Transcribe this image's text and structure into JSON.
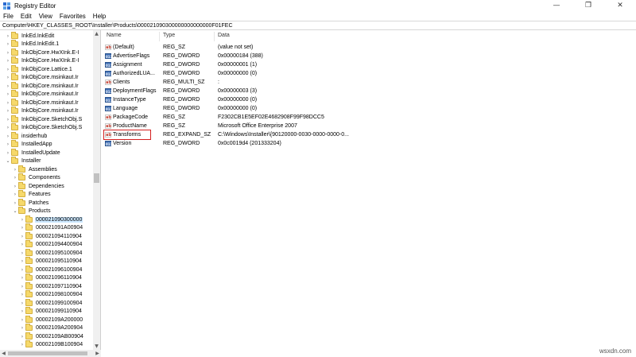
{
  "window": {
    "title": "Registry Editor",
    "controls": {
      "minimize": "—",
      "maximize": "❐",
      "close": "✕"
    }
  },
  "menu": [
    "File",
    "Edit",
    "View",
    "Favorites",
    "Help"
  ],
  "address": "Computer\\HKEY_CLASSES_ROOT\\Installer\\Products\\000021090300000000000000F01FEC",
  "tree": [
    {
      "label": "InkEd.InkEdit",
      "indent": 1,
      "chevron": "›"
    },
    {
      "label": "InkEd.InkEdit.1",
      "indent": 1,
      "chevron": "›"
    },
    {
      "label": "InkObjCore.HwXInk.E-I",
      "indent": 1,
      "chevron": "›"
    },
    {
      "label": "InkObjCore.HwXInk.E-I",
      "indent": 1,
      "chevron": "›"
    },
    {
      "label": "InkObjCore.Lattice.1",
      "indent": 1,
      "chevron": "›"
    },
    {
      "label": "InkObjCore.msinkaut.Ir",
      "indent": 1,
      "chevron": "›"
    },
    {
      "label": "InkObjCore.msinkaut.Ir",
      "indent": 1,
      "chevron": "›"
    },
    {
      "label": "InkObjCore.msinkaut.Ir",
      "indent": 1,
      "chevron": "›"
    },
    {
      "label": "InkObjCore.msinkaut.Ir",
      "indent": 1,
      "chevron": "›"
    },
    {
      "label": "InkObjCore.msinkaut.Ir",
      "indent": 1,
      "chevron": "›"
    },
    {
      "label": "InkObjCore.SketchObj.S",
      "indent": 1,
      "chevron": "›"
    },
    {
      "label": "InkObjCore.SketchObj.S",
      "indent": 1,
      "chevron": "›"
    },
    {
      "label": "insiderhub",
      "indent": 1,
      "chevron": "›"
    },
    {
      "label": "InstalledApp",
      "indent": 1,
      "chevron": "›"
    },
    {
      "label": "InstalledUpdate",
      "indent": 1,
      "chevron": "›"
    },
    {
      "label": "Installer",
      "indent": 1,
      "chevron": "⌄"
    },
    {
      "label": "Assemblies",
      "indent": 2,
      "chevron": "›"
    },
    {
      "label": "Components",
      "indent": 2,
      "chevron": "›"
    },
    {
      "label": "Dependencies",
      "indent": 2,
      "chevron": "›"
    },
    {
      "label": "Features",
      "indent": 2,
      "chevron": "›"
    },
    {
      "label": "Patches",
      "indent": 2,
      "chevron": "›"
    },
    {
      "label": "Products",
      "indent": 2,
      "chevron": "⌄"
    },
    {
      "label": "000021090300000",
      "indent": 3,
      "chevron": "›",
      "selected": true
    },
    {
      "label": "000021091A00904",
      "indent": 3,
      "chevron": "›"
    },
    {
      "label": "000021094110904",
      "indent": 3,
      "chevron": "›"
    },
    {
      "label": "000021094400904",
      "indent": 3,
      "chevron": "›"
    },
    {
      "label": "000021095100904",
      "indent": 3,
      "chevron": "›"
    },
    {
      "label": "000021095110904",
      "indent": 3,
      "chevron": "›"
    },
    {
      "label": "000021096100904",
      "indent": 3,
      "chevron": "›"
    },
    {
      "label": "000021096110904",
      "indent": 3,
      "chevron": "›"
    },
    {
      "label": "000021097110904",
      "indent": 3,
      "chevron": "›"
    },
    {
      "label": "000021098100904",
      "indent": 3,
      "chevron": "›"
    },
    {
      "label": "000021099100904",
      "indent": 3,
      "chevron": "›"
    },
    {
      "label": "000021099110904",
      "indent": 3,
      "chevron": "›"
    },
    {
      "label": "00002109A200000",
      "indent": 3,
      "chevron": "›"
    },
    {
      "label": "00002109A200904",
      "indent": 3,
      "chevron": "›"
    },
    {
      "label": "00002109AB00904",
      "indent": 3,
      "chevron": "›"
    },
    {
      "label": "00002109B100904",
      "indent": 3,
      "chevron": "›"
    }
  ],
  "columns": {
    "name": "Name",
    "type": "Type",
    "data": "Data"
  },
  "values": [
    {
      "name": "(Default)",
      "type": "REG_SZ",
      "data": "(value not set)",
      "kind": "ab"
    },
    {
      "name": "AdvertiseFlags",
      "type": "REG_DWORD",
      "data": "0x00000184 (388)",
      "kind": "bin"
    },
    {
      "name": "Assignment",
      "type": "REG_DWORD",
      "data": "0x00000001 (1)",
      "kind": "bin"
    },
    {
      "name": "AuthorizedLUA...",
      "type": "REG_DWORD",
      "data": "0x00000000 (0)",
      "kind": "bin"
    },
    {
      "name": "Clients",
      "type": "REG_MULTI_SZ",
      "data": ":",
      "kind": "ab"
    },
    {
      "name": "DeploymentFlags",
      "type": "REG_DWORD",
      "data": "0x00000003 (3)",
      "kind": "bin"
    },
    {
      "name": "InstanceType",
      "type": "REG_DWORD",
      "data": "0x00000000 (0)",
      "kind": "bin"
    },
    {
      "name": "Language",
      "type": "REG_DWORD",
      "data": "0x00000000 (0)",
      "kind": "bin"
    },
    {
      "name": "PackageCode",
      "type": "REG_SZ",
      "data": "F2302CB1E5EF02E4682908F99F98DCC5",
      "kind": "ab"
    },
    {
      "name": "ProductName",
      "type": "REG_SZ",
      "data": "Microsoft Office Enterprise 2007",
      "kind": "ab"
    },
    {
      "name": "Transforms",
      "type": "REG_EXPAND_SZ",
      "data": "C:\\Windows\\Installer\\{90120000-0030-0000-0000-0...",
      "kind": "ab"
    },
    {
      "name": "Version",
      "type": "REG_DWORD",
      "data": "0x0c0019d4 (201333204)",
      "kind": "bin"
    }
  ],
  "highlighted_value": "Transforms",
  "highlight_color": "#d32020",
  "watermark": "wsxdn.com"
}
